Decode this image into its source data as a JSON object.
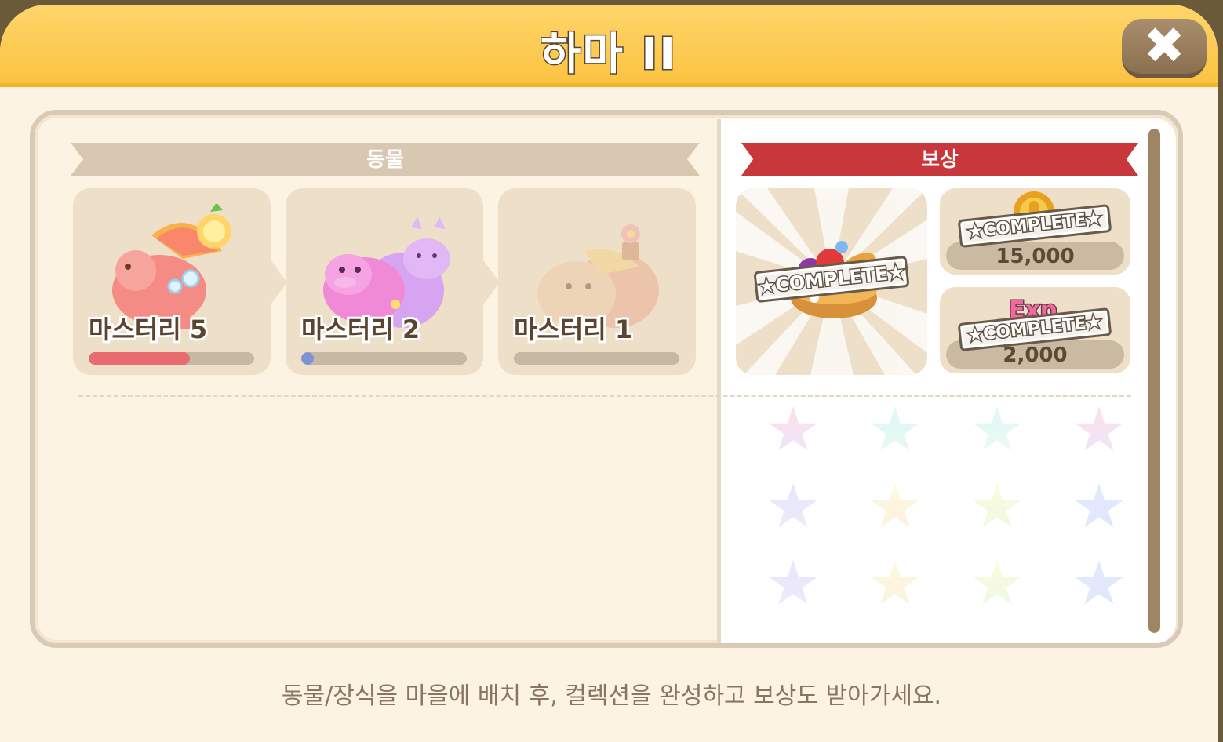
{
  "window": {
    "title": "하마 II",
    "close_label": "✖"
  },
  "animals": {
    "ribbon_label": "동물",
    "cards": [
      {
        "name": "grapefruit-hippo",
        "mastery_label": "마스터리 5",
        "progress": 0.61,
        "bar_color": "#e96a6f"
      },
      {
        "name": "purple-hippo",
        "mastery_label": "마스터리 2",
        "progress": 0.07,
        "bar_color": "#7f93d4"
      },
      {
        "name": "flower-hippo",
        "mastery_label": "마스터리 1",
        "progress": 0.0,
        "bar_color": "#c7b8a4"
      }
    ]
  },
  "reward": {
    "ribbon_label": "보상",
    "main_item": {
      "icon": "fruit-basket-icon",
      "stamp": "★COMPLETE★"
    },
    "coins": {
      "icon": "gold-coin-icon",
      "amount": "15,000",
      "stamp": "★COMPLETE★"
    },
    "exp": {
      "label": "Exp",
      "amount": "2,000",
      "stamp": "★COMPLETE★"
    }
  },
  "footer": {
    "hint": "동물/장식을 마을에 배치 후, 컬렉션을 완성하고 보상도 받아가세요."
  },
  "colors": {
    "header": "#fbc342",
    "reward_ribbon": "#c8373c",
    "animal_ribbon": "#d8c7b1"
  }
}
